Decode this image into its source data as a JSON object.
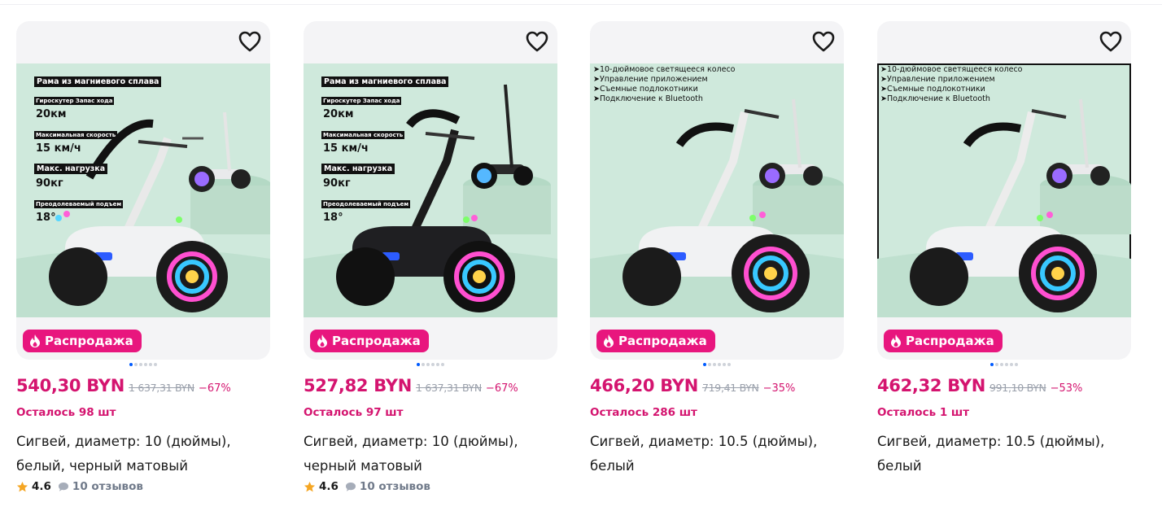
{
  "products": [
    {
      "badge": "Распродажа",
      "price": "540,30 BYN",
      "old_price": "1 637,31 BYN",
      "discount": "−67%",
      "stock": "Осталось 98 шт",
      "title": "Сигвей, диаметр: 10 (дюймы), белый, черный матовый",
      "rating": "4.6",
      "reviews": "10 отзывов",
      "frame_color": "white",
      "image_text": {
        "t1": "Рама из магниевого сплава",
        "t2": "Гироскутер Запас хода",
        "v2": "20км",
        "t3": "Максимальная скорость",
        "v3": "15 км/ч",
        "t4": "Макс. нагрузка",
        "v4": "90кг",
        "t5": "Преодолеваемый подъем",
        "v5": "18°"
      }
    },
    {
      "badge": "Распродажа",
      "price": "527,82 BYN",
      "old_price": "1 637,31 BYN",
      "discount": "−67%",
      "stock": "Осталось 97 шт",
      "title": "Сигвей, диаметр: 10 (дюймы), черный матовый",
      "rating": "4.6",
      "reviews": "10 отзывов",
      "frame_color": "black",
      "image_text": {
        "t1": "Рама из магниевого сплава",
        "t2": "Гироскутер Запас хода",
        "v2": "20км",
        "t3": "Максимальная скорость",
        "v3": "15 км/ч",
        "t4": "Макс. нагрузка",
        "v4": "90кг",
        "t5": "Преодолеваемый подъем",
        "v5": "18°"
      }
    },
    {
      "badge": "Распродажа",
      "price": "466,20 BYN",
      "old_price": "719,41 BYN",
      "discount": "−35%",
      "stock": "Осталось 286 шт",
      "title": "Сигвей, диаметр: 10.5 (дюймы), белый",
      "frame_color": "white",
      "image_bullets": [
        "➤10-дюймовое светящееся колесо",
        "➤Управление приложением",
        "➤Съемные подлокотники",
        "➤Подключение к Bluetooth"
      ]
    },
    {
      "badge": "Распродажа",
      "price": "462,32 BYN",
      "old_price": "991,10 BYN",
      "discount": "−53%",
      "stock": "Осталось 1 шт",
      "title": "Сигвей, диаметр: 10.5 (дюймы), белый",
      "frame_color": "white",
      "image_bullets": [
        "➤10-дюймовое светящееся колесо",
        "➤Управление приложением",
        "➤Съемные подлокотники",
        "➤Подключение к Bluetooth"
      ]
    }
  ],
  "colors": {
    "accent": "#e8167e",
    "price": "#d4146f",
    "star": "#f5a623",
    "dot_active": "#005bff",
    "image_bg": "#cfe9dc"
  },
  "icons": [
    "heart-outline-icon",
    "flame-icon",
    "star-icon",
    "comment-icon"
  ]
}
